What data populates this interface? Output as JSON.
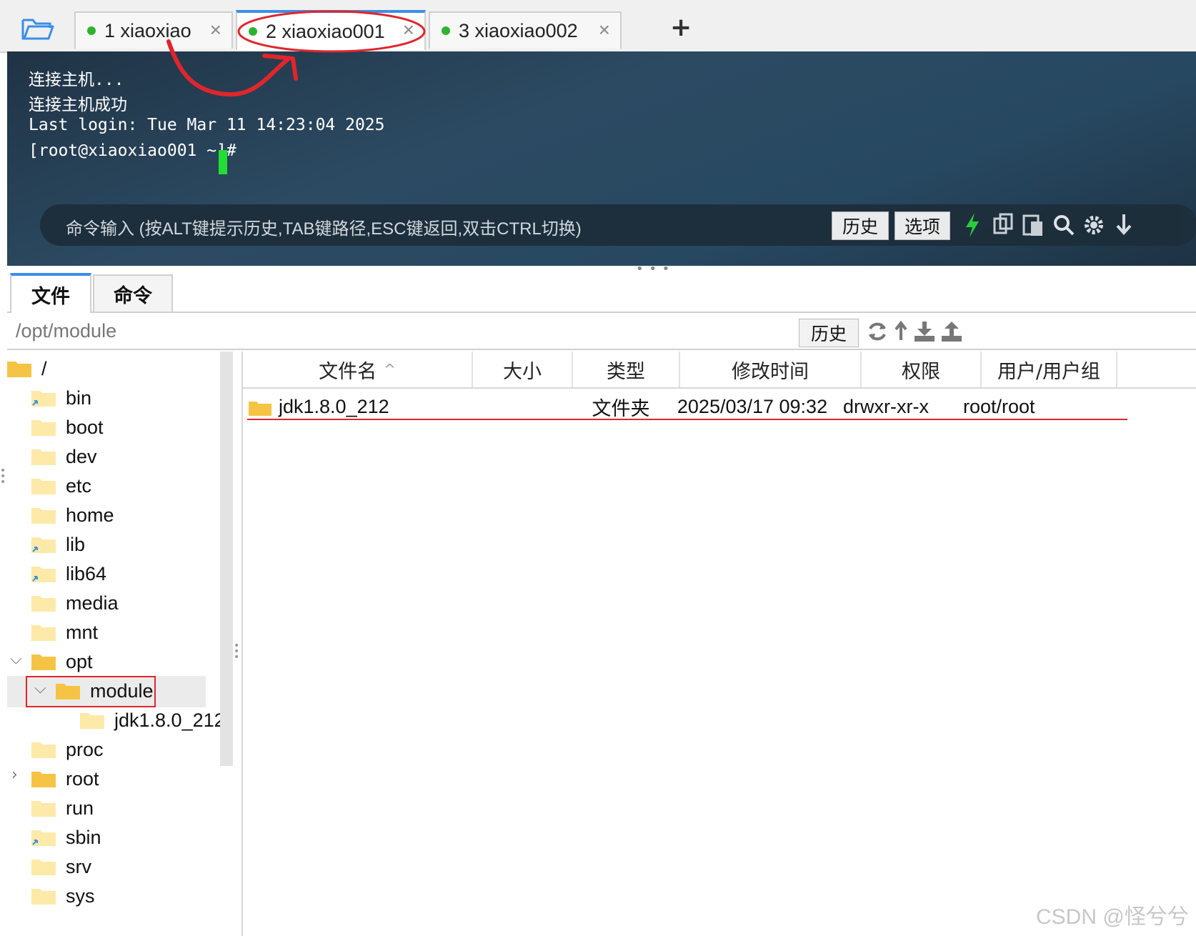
{
  "tabs": [
    {
      "label": "1  xiaoxiao",
      "close": "×"
    },
    {
      "label": "2  xiaoxiao001",
      "close": "×"
    },
    {
      "label": "3  xiaoxiao002",
      "close": "×"
    }
  ],
  "add_tab": "+",
  "terminal": {
    "lines": [
      "连接主机...",
      "连接主机成功",
      "Last login: Tue Mar 11 14:23:04 2025",
      "[root@xiaoxiao001 ~]# "
    ]
  },
  "command_bar": {
    "placeholder": "命令输入 (按ALT键提示历史,TAB键路径,ESC键返回,双击CTRL切换)",
    "history_label": "历史",
    "options_label": "选项",
    "icons": [
      "lightning-icon",
      "copy-icon",
      "paste-icon",
      "search-icon",
      "gear-icon",
      "download-icon"
    ]
  },
  "lower_tabs": [
    "文件",
    "命令"
  ],
  "path_bar": {
    "path": "/opt/module",
    "history_label": "历史",
    "icons": [
      "refresh-icon",
      "up-icon",
      "download-icon",
      "upload-icon"
    ]
  },
  "tree": {
    "items": [
      {
        "label": "/",
        "depth": 0
      },
      {
        "label": "bin",
        "depth": 1
      },
      {
        "label": "boot",
        "depth": 1
      },
      {
        "label": "dev",
        "depth": 1
      },
      {
        "label": "etc",
        "depth": 1
      },
      {
        "label": "home",
        "depth": 1
      },
      {
        "label": "lib",
        "depth": 1
      },
      {
        "label": "lib64",
        "depth": 1
      },
      {
        "label": "media",
        "depth": 1
      },
      {
        "label": "mnt",
        "depth": 1
      },
      {
        "label": "opt",
        "depth": 1
      },
      {
        "label": "module",
        "depth": 2
      },
      {
        "label": "jdk1.8.0_212",
        "depth": 3
      },
      {
        "label": "proc",
        "depth": 1
      },
      {
        "label": "root",
        "depth": 1
      },
      {
        "label": "run",
        "depth": 1
      },
      {
        "label": "sbin",
        "depth": 1
      },
      {
        "label": "srv",
        "depth": 1
      },
      {
        "label": "sys",
        "depth": 1
      }
    ]
  },
  "file_table": {
    "columns": [
      "文件名",
      "大小",
      "类型",
      "修改时间",
      "权限",
      "用户/用户组"
    ],
    "sort_indicator": "^",
    "rows": [
      {
        "name": "jdk1.8.0_212",
        "size": "",
        "type": "文件夹",
        "modified": "2025/03/17 09:32",
        "perm": "drwxr-xr-x",
        "owner": "root/root"
      }
    ]
  },
  "watermark": "CSDN @怪兮兮",
  "colors": {
    "accent": "#3a8ee6",
    "status_green": "#2fb32f",
    "annotation_red": "#e0262b",
    "folder_yellow": "#f6c445"
  }
}
